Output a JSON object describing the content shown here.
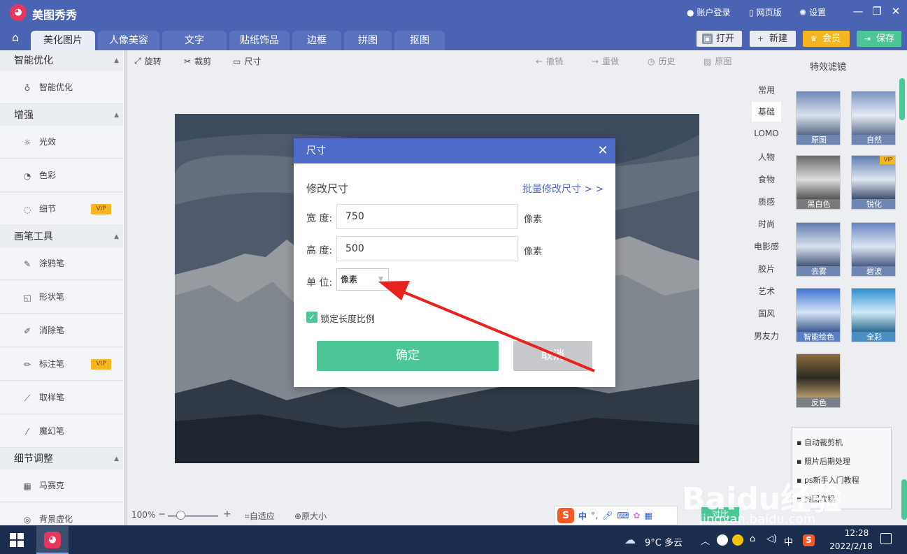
{
  "app": {
    "title": "美图秀秀",
    "logo_glyph": "◕"
  },
  "header_right": {
    "login": "账户登录",
    "web": "网页版",
    "settings": "设置"
  },
  "tabs": [
    "美化图片",
    "人像美容",
    "文字",
    "贴纸饰品",
    "边框",
    "拼图",
    "抠图"
  ],
  "actions": {
    "open": "打开",
    "new": "新建",
    "vip": "会员",
    "save": "保存"
  },
  "toolbar": {
    "rotate": "旋转",
    "crop": "裁剪",
    "size": "尺寸",
    "undo": "撤销",
    "redo": "重做",
    "history": "历史",
    "original": "原图"
  },
  "sidebar": {
    "sections": [
      "智能优化",
      "增强",
      "画笔工具",
      "细节调整"
    ],
    "items": {
      "smart": "智能优化",
      "light": "光效",
      "color": "色彩",
      "detail": "细节",
      "doodle": "涂鸦笔",
      "shape": "形状笔",
      "eraser": "消除笔",
      "marker": "标注笔",
      "picker": "取样笔",
      "magic": "魔幻笔",
      "mosaic": "马赛克",
      "blur": "背景虚化"
    },
    "vip_label": "VIP"
  },
  "right_panel": {
    "title": "特效滤镜",
    "categories": [
      "常用",
      "基础",
      "LOMO",
      "人物",
      "食物",
      "质感",
      "时尚",
      "电影感",
      "胶片",
      "艺术",
      "国风",
      "男友力"
    ],
    "filters": [
      "原图",
      "自然",
      "黑白色",
      "锐化",
      "去雾",
      "碧波",
      "智能绘色",
      "全彩",
      "反色"
    ],
    "filter_vip": "VIP",
    "tips": [
      "自动裁剪机",
      "照片后期处理",
      "ps新手入门教程",
      "美图教程"
    ]
  },
  "bottom": {
    "zoom": "100%",
    "fit": "自适应",
    "actual": "原大小",
    "compare": "对比"
  },
  "dialog": {
    "title": "尺寸",
    "subtitle": "修改尺寸",
    "batch_link": "批量修改尺寸 > >",
    "width_label": "宽 度:",
    "width_value": "750",
    "height_label": "高 度:",
    "height_value": "500",
    "unit_px": "像素",
    "unit_label": "单 位:",
    "unit_value": "像素",
    "lock_label": "锁定长度比例",
    "lock_checked": true,
    "ok": "确定",
    "cancel": "取消"
  },
  "ime": {
    "label": "中",
    "punct": "°,"
  },
  "taskbar": {
    "weather": "9°C  多云",
    "ime": "中",
    "time": "12:28",
    "date": "2022/2/18"
  },
  "watermark": {
    "brand": "Baidu经验",
    "url": "jingyan.baidu.com"
  },
  "colors": {
    "header": "#4a63b3",
    "accent_blue": "#4e6bc7",
    "ok_green": "#4cc597",
    "vip_gold": "#f5b622",
    "arrow_red": "#e8221c"
  }
}
